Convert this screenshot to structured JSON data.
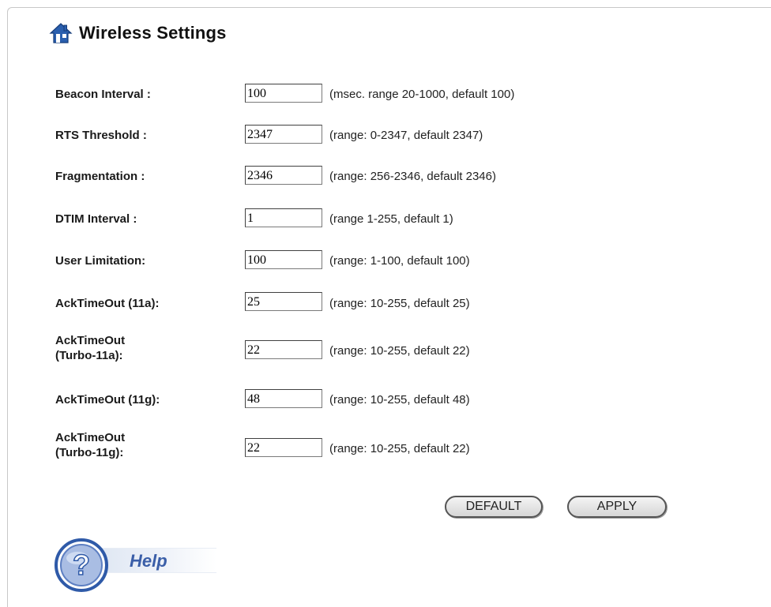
{
  "page": {
    "title": "Wireless Settings"
  },
  "settings": [
    {
      "label": "Beacon Interval :",
      "value": "100",
      "hint": "(msec. range 20-1000, default 100)"
    },
    {
      "label": "RTS Threshold :",
      "value": "2347",
      "hint": "(range: 0-2347, default 2347)"
    },
    {
      "label": "Fragmentation :",
      "value": "2346",
      "hint": "(range: 256-2346, default 2346)"
    },
    {
      "label": "DTIM Interval :",
      "value": "1",
      "hint": "(range 1-255, default 1)"
    },
    {
      "label": "User Limitation:",
      "value": "100",
      "hint": "(range: 1-100, default 100)"
    },
    {
      "label": "AckTimeOut (11a):",
      "value": "25",
      "hint": "(range: 10-255, default 25)"
    },
    {
      "label_line1": "AckTimeOut",
      "label_line2": "(Turbo-11a):",
      "value": "22",
      "hint": "(range: 10-255, default 22)"
    },
    {
      "label": "AckTimeOut (11g):",
      "value": "48",
      "hint": "(range: 10-255, default 48)"
    },
    {
      "label_line1": "AckTimeOut",
      "label_line2": "(Turbo-11g):",
      "value": "22",
      "hint": "(range: 10-255, default 22)"
    }
  ],
  "buttons": {
    "default_label": "DEFAULT",
    "apply_label": "APPLY"
  },
  "help": {
    "label": "Help"
  },
  "icons": {
    "title": "home-icon",
    "help": "question-mark-icon"
  },
  "colors": {
    "help_text": "#3a5ea8",
    "home_icon": "#2a5fae"
  }
}
